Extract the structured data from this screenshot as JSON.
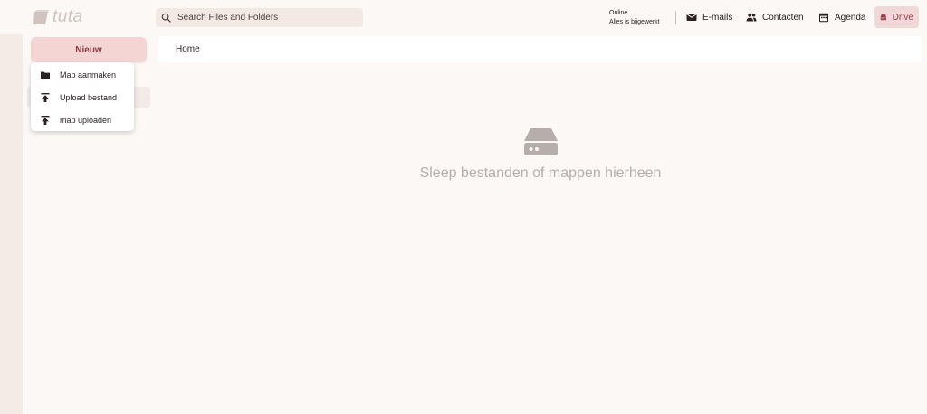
{
  "app": {
    "logo_text": "tuta"
  },
  "search": {
    "placeholder": "Search Files and Folders"
  },
  "status": {
    "line1": "Online",
    "line2": "Alles is bijgewerkt"
  },
  "nav": [
    {
      "label": "E-mails",
      "icon": "mail-icon"
    },
    {
      "label": "Contacten",
      "icon": "contacts-icon"
    },
    {
      "label": "Agenda",
      "icon": "calendar-icon"
    },
    {
      "label": "Drive",
      "icon": "drive-icon",
      "active": true
    }
  ],
  "sidebar": {
    "new_button": "Nieuw"
  },
  "new_menu": {
    "items": [
      {
        "label": "Map aanmaken",
        "icon": "folder-icon"
      },
      {
        "label": "Upload bestand",
        "icon": "upload-icon"
      },
      {
        "label": "map uploaden",
        "icon": "upload-icon"
      }
    ]
  },
  "breadcrumb": {
    "current": "Home"
  },
  "empty_state": {
    "icon": "drive-icon",
    "message": "Sleep bestanden of mappen hierheen"
  },
  "colors": {
    "background": "#fcf8f5",
    "accent": "#9c3a47",
    "accent_bg": "#f5d5d4",
    "muted_text": "#b6aeab"
  }
}
